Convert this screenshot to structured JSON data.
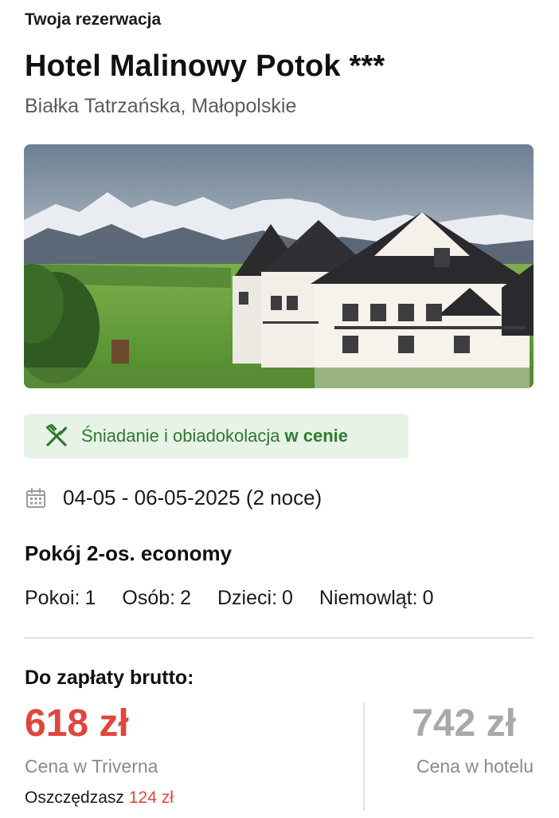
{
  "header": {
    "section_label": "Twoja rezerwacja",
    "hotel_name": "Hotel Malinowy Potok ***",
    "location": "Białka Tatrzańska, Małopolskie"
  },
  "meal": {
    "icon": "fork-knife-icon",
    "text": "Śniadanie i obiadokolacja",
    "emphasis": "w cenie",
    "color": "#2e7a2e",
    "background": "#e6f3e6"
  },
  "stay": {
    "icon": "calendar-icon",
    "dates": "04-05 - 06-05-2025 (2 noce)"
  },
  "room": {
    "name": "Pokój 2-os. economy"
  },
  "occupancy": [
    {
      "label": "Pokoi:",
      "value": "1"
    },
    {
      "label": "Osób:",
      "value": "2"
    },
    {
      "label": "Dzieci:",
      "value": "0"
    },
    {
      "label": "Niemowląt:",
      "value": "0"
    }
  ],
  "payment": {
    "label": "Do zapłaty brutto:",
    "price": "618 zł",
    "price_caption": "Cena w Triverna",
    "savings_label": "Oszczędzasz",
    "savings_amount": "124 zł",
    "hotel_price": "742 zł",
    "hotel_price_caption": "Cena w hotelu",
    "accent_color": "#e0463b"
  }
}
